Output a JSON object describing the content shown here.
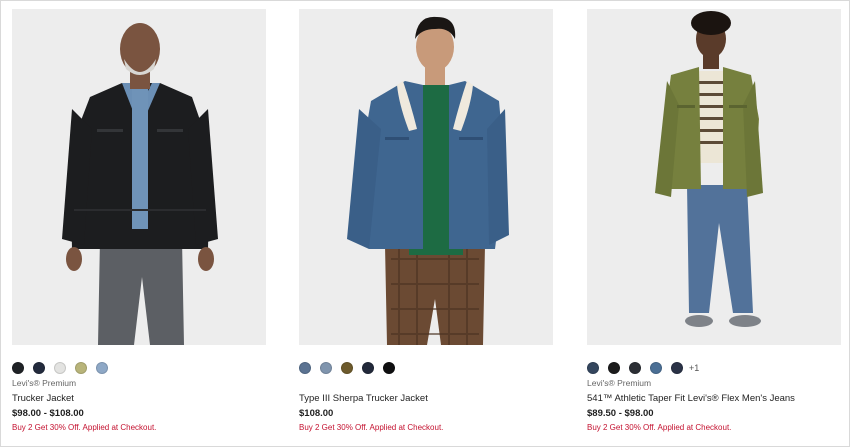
{
  "products": [
    {
      "brand": "Levi's® Premium",
      "name": "Trucker Jacket",
      "price": "$98.00 - $108.00",
      "promo": "Buy 2 Get 30% Off. Applied at Checkout.",
      "swatches": [
        "#1f2226",
        "#232b3d",
        "#e3e3e1",
        "#b8b47a",
        "#8ea8c6"
      ],
      "more": ""
    },
    {
      "brand": "",
      "name": "Type III Sherpa Trucker Jacket",
      "price": "$108.00",
      "promo": "Buy 2 Get 30% Off. Applied at Checkout.",
      "swatches": [
        "#5b7392",
        "#8095ae",
        "#6d5a2c",
        "#22293a",
        "#0f0f10"
      ],
      "more": ""
    },
    {
      "brand": "Levi's® Premium",
      "name": "541™ Athletic Taper Fit Levi's® Flex Men's Jeans",
      "price": "$89.50 - $98.00",
      "promo": "Buy 2 Get 30% Off. Applied at Checkout.",
      "swatches": [
        "#34465e",
        "#1b1b1c",
        "#2c2f35",
        "#4b6f95",
        "#2a3246"
      ],
      "more": "+1"
    }
  ],
  "colors": {
    "promo": "#c41230",
    "image_background": "#ededed"
  }
}
